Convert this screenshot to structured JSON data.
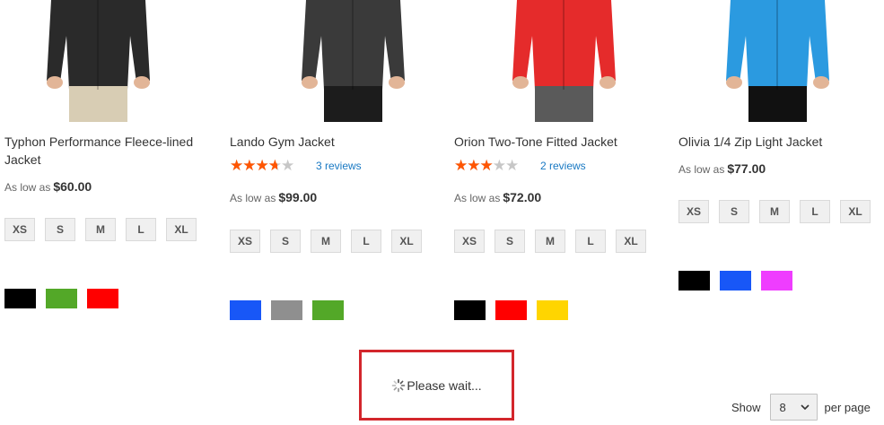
{
  "products": [
    {
      "name": "Typhon Performance Fleece-lined Jacket",
      "rating_fraction": null,
      "reviews": "",
      "price_label": "As low as",
      "price": "$60.00",
      "sizes": [
        "XS",
        "S",
        "M",
        "L",
        "XL"
      ],
      "colors": [
        "#000000",
        "#53a828",
        "#ff0000"
      ],
      "jacket_color": "#2a2a2a",
      "pants_color": "#d8cdb4"
    },
    {
      "name": "Lando Gym Jacket",
      "rating_fraction": 0.6,
      "reviews": "3 reviews",
      "price_label": "As low as",
      "price": "$99.00",
      "sizes": [
        "XS",
        "S",
        "M",
        "L",
        "XL"
      ],
      "colors": [
        "#1857f7",
        "#8f8f8f",
        "#53a828"
      ],
      "jacket_color": "#3a3a3a",
      "pants_color": "#1c1c1c"
    },
    {
      "name": "Orion Two-Tone Fitted Jacket",
      "rating_fraction": 0.5,
      "reviews": "2 reviews",
      "price_label": "As low as",
      "price": "$72.00",
      "sizes": [
        "XS",
        "S",
        "M",
        "L",
        "XL"
      ],
      "colors": [
        "#000000",
        "#ff0000",
        "#ffd500"
      ],
      "jacket_color": "#e52b2b",
      "pants_color": "#5a5a5a"
    },
    {
      "name": "Olivia 1/4 Zip Light Jacket",
      "rating_fraction": null,
      "reviews": "",
      "price_label": "As low as",
      "price": "$77.00",
      "sizes": [
        "XS",
        "S",
        "M",
        "L",
        "XL"
      ],
      "colors": [
        "#000000",
        "#1857f7",
        "#ef3dff"
      ],
      "jacket_color": "#2b9ae0",
      "pants_color": "#111111"
    }
  ],
  "loader": {
    "text": "Please wait...",
    "icon": "spinner-icon"
  },
  "toolbar": {
    "show_label": "Show",
    "limit_value": "8",
    "per_page_label": "per page"
  },
  "colors": {
    "star_filled": "#ff5501",
    "star_empty": "#c7c7c7",
    "link": "#1979c3",
    "loader_border": "#d3262c"
  }
}
